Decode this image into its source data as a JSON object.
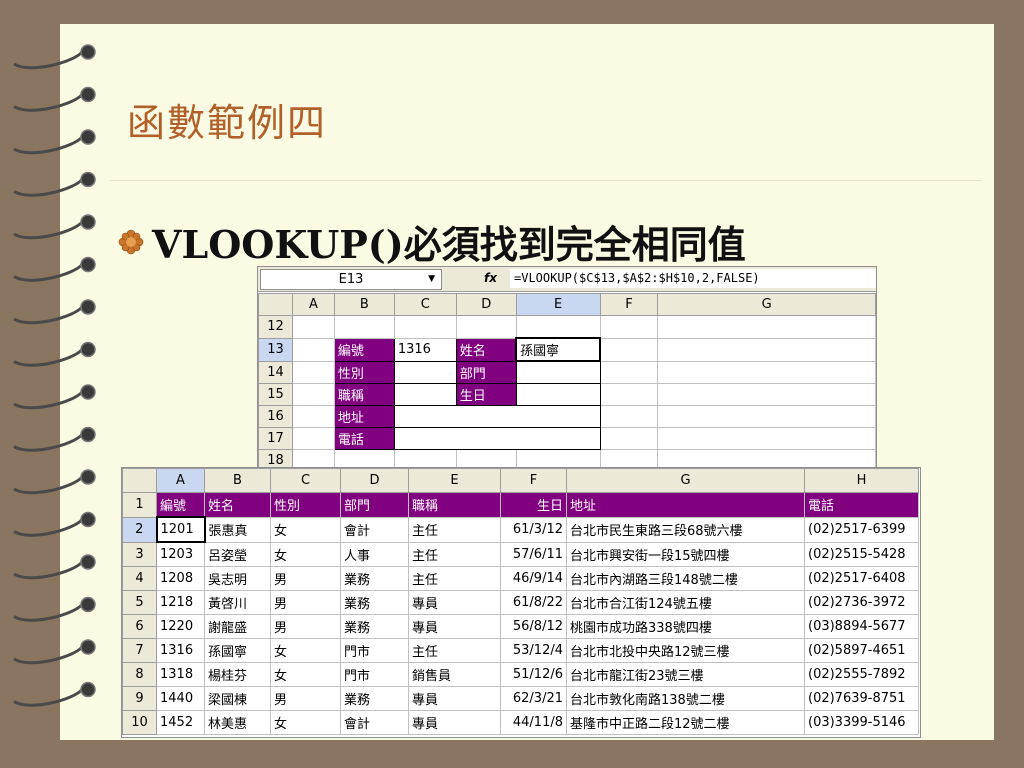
{
  "slide": {
    "title": "函數範例四",
    "bullet": "VLOOKUP()必須找到完全相同值",
    "colors": {
      "title": "#b2602a",
      "frame": "#8a7560",
      "page": "#fbfbe4",
      "header_fill": "#800080"
    }
  },
  "top_sheet": {
    "name_box": "E13",
    "fx_label": "fx",
    "formula": "=VLOOKUP($C$13,$A$2:$H$10,2,FALSE)",
    "columns": [
      "",
      "A",
      "B",
      "C",
      "D",
      "E",
      "F",
      "G"
    ],
    "rows": [
      "12",
      "13",
      "14",
      "15",
      "16",
      "17",
      "18"
    ],
    "labels": {
      "id": "編號",
      "gender": "性別",
      "title": "職稱",
      "address": "地址",
      "phone": "電話",
      "name": "姓名",
      "dept": "部門",
      "birthday": "生日"
    },
    "values": {
      "id": "1316",
      "name": "孫國寧"
    }
  },
  "bottom_sheet": {
    "columns": [
      "",
      "A",
      "B",
      "C",
      "D",
      "E",
      "F",
      "G",
      "H"
    ],
    "headers": [
      "1",
      "編號",
      "姓名",
      "性別",
      "部門",
      "職稱",
      "生日",
      "地址",
      "電話"
    ],
    "rows": [
      [
        "2",
        "1201",
        "張惠真",
        "女",
        "會計",
        "主任",
        "61/3/12",
        "台北市民生東路三段68號六樓",
        "(02)2517-6399"
      ],
      [
        "3",
        "1203",
        "呂姿瑩",
        "女",
        "人事",
        "主任",
        "57/6/11",
        "台北市興安街一段15號四樓",
        "(02)2515-5428"
      ],
      [
        "4",
        "1208",
        "吳志明",
        "男",
        "業務",
        "主任",
        "46/9/14",
        "台北市內湖路三段148號二樓",
        "(02)2517-6408"
      ],
      [
        "5",
        "1218",
        "黃啓川",
        "男",
        "業務",
        "專員",
        "61/8/22",
        "台北市合江街124號五樓",
        "(02)2736-3972"
      ],
      [
        "6",
        "1220",
        "謝龍盛",
        "男",
        "業務",
        "專員",
        "56/8/12",
        "桃園市成功路338號四樓",
        "(03)8894-5677"
      ],
      [
        "7",
        "1316",
        "孫國寧",
        "女",
        "門市",
        "主任",
        "53/12/4",
        "台北市北投中央路12號三樓",
        "(02)5897-4651"
      ],
      [
        "8",
        "1318",
        "楊桂芬",
        "女",
        "門市",
        "銷售員",
        "51/12/6",
        "台北市龍江街23號三樓",
        "(02)2555-7892"
      ],
      [
        "9",
        "1440",
        "梁國棟",
        "男",
        "業務",
        "專員",
        "62/3/21",
        "台北市敦化南路138號二樓",
        "(02)7639-8751"
      ],
      [
        "10",
        "1452",
        "林美惠",
        "女",
        "會計",
        "專員",
        "44/11/8",
        "基隆市中正路二段12號二樓",
        "(03)3399-5146"
      ]
    ]
  }
}
